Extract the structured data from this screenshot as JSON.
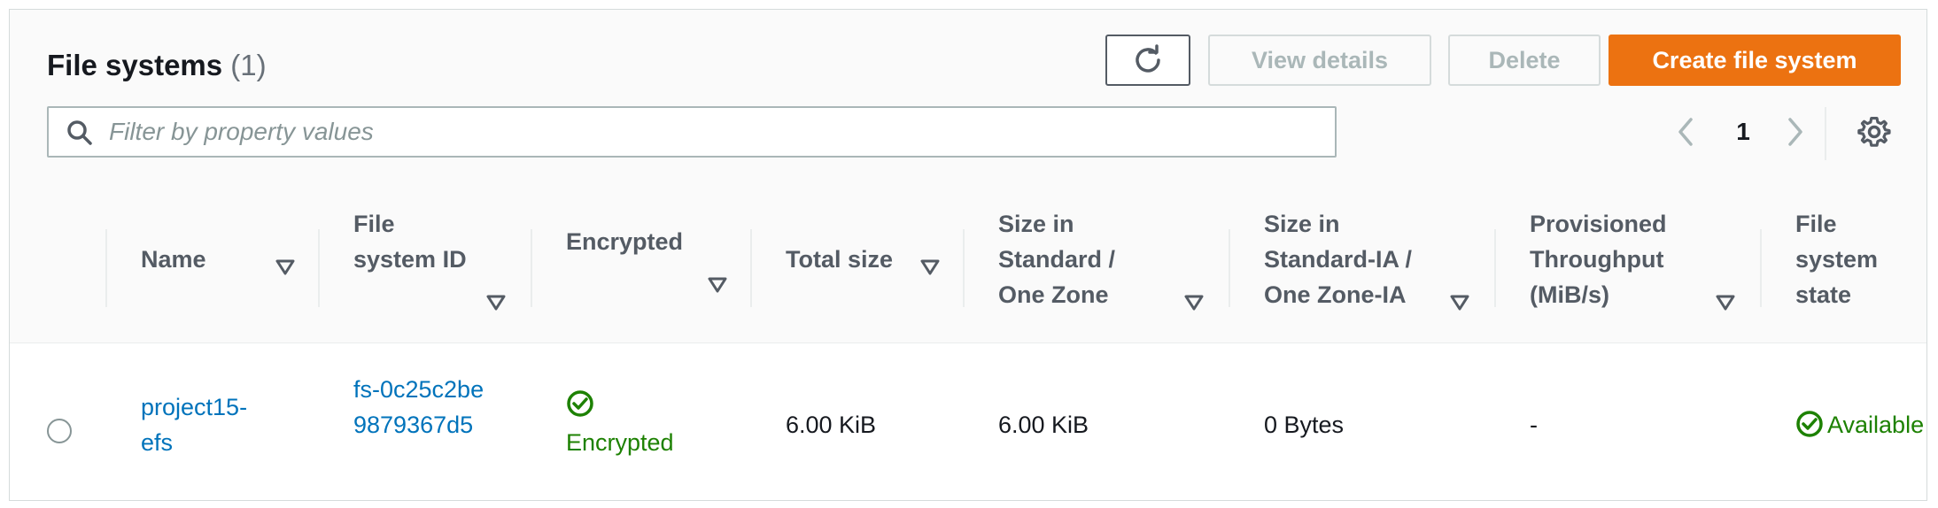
{
  "header": {
    "title": "File systems",
    "count": "(1)",
    "buttons": {
      "view_details": "View details",
      "delete": "Delete",
      "create": "Create file system"
    },
    "filter_placeholder": "Filter by property values",
    "page": "1"
  },
  "columns": [
    "Name",
    "File system ID",
    "Encrypted",
    "Total size",
    "Size in Standard / One Zone",
    "Size in Standard-IA / One Zone-IA",
    "Provisioned Throughput (MiB/s)",
    "File system state"
  ],
  "rows": [
    {
      "name": "project15-efs",
      "file_system_id": "fs-0c25c2be9879367d5",
      "encrypted": "Encrypted",
      "total_size": "6.00 KiB",
      "size_standard": "6.00 KiB",
      "size_ia": "0 Bytes",
      "provisioned_throughput": "-",
      "state": "Available"
    }
  ],
  "colors": {
    "primary": "#ec7211",
    "link": "#0073bb",
    "success": "#1d8102"
  }
}
